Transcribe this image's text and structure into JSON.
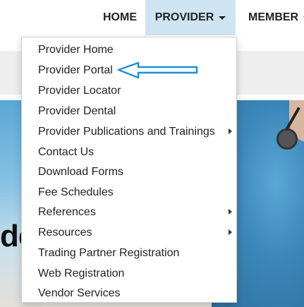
{
  "nav": {
    "items": [
      {
        "label": "HOME"
      },
      {
        "label": "PROVIDER",
        "active": true
      },
      {
        "label": "MEMBER"
      }
    ]
  },
  "dropdown": {
    "items": [
      {
        "label": "Provider Home",
        "submenu": false
      },
      {
        "label": "Provider Portal",
        "submenu": false
      },
      {
        "label": "Provider Locator",
        "submenu": false
      },
      {
        "label": "Provider Dental",
        "submenu": false
      },
      {
        "label": "Provider Publications and Trainings",
        "submenu": true
      },
      {
        "label": "Contact Us",
        "submenu": false
      },
      {
        "label": "Download Forms",
        "submenu": false
      },
      {
        "label": "Fee Schedules",
        "submenu": false
      },
      {
        "label": "References",
        "submenu": true
      },
      {
        "label": "Resources",
        "submenu": true
      },
      {
        "label": "Trading Partner Registration",
        "submenu": false
      },
      {
        "label": "Web Registration",
        "submenu": false
      },
      {
        "label": "Vendor Services",
        "submenu": false
      }
    ]
  },
  "hero": {
    "heading_fragment": "de"
  },
  "colors": {
    "active_tab": "#cfe4f3",
    "annotation_arrow": "#1e90d6"
  }
}
